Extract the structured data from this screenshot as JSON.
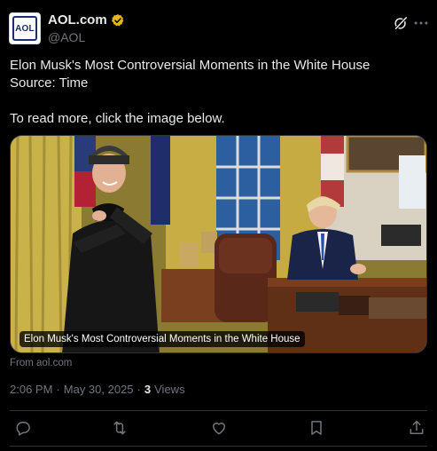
{
  "header": {
    "display_name": "AOL.com",
    "handle": "@AOL",
    "avatar_text": "AOL"
  },
  "post": {
    "lines": [
      "Elon Musk's Most Controversial Moments in the White House",
      "Source: Time",
      "",
      "To read more, click the image below."
    ]
  },
  "card": {
    "caption": "Elon Musk's Most Controversial Moments in the White House",
    "from": "From aol.com"
  },
  "meta": {
    "time": "2:06 PM",
    "separator": "·",
    "date": "May 30, 2025",
    "views_count": "3",
    "views_label": "Views"
  },
  "icons": {
    "verified": "verified-gold-badge-icon",
    "grok": "grok-icon",
    "more": "more-dots-icon",
    "reply": "reply-icon",
    "repost": "repost-icon",
    "like": "like-icon",
    "bookmark": "bookmark-icon",
    "share": "share-icon"
  },
  "colors": {
    "background": "#000000",
    "text": "#e7e9ea",
    "muted": "#71767b",
    "verified_gold": "#e2b719",
    "border": "#2f3336"
  }
}
